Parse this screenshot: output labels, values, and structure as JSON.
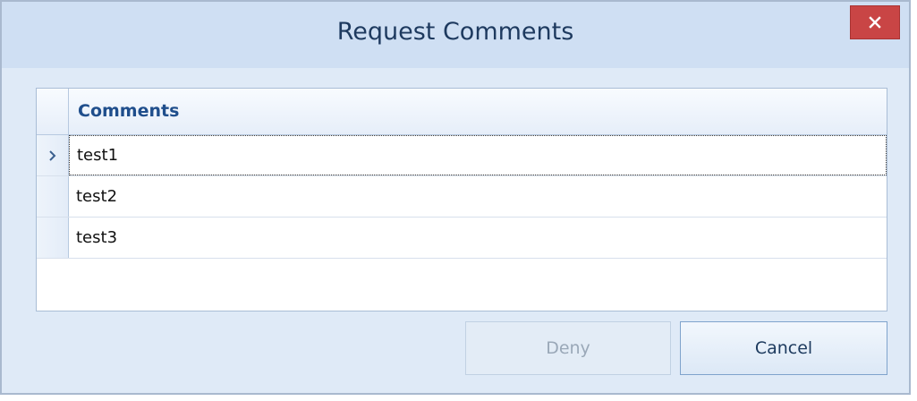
{
  "window": {
    "title": "Request Comments",
    "close_icon": "close-icon"
  },
  "grid": {
    "column_header": "Comments",
    "current_row_icon": "chevron-right-icon",
    "rows": [
      {
        "comment": "test1",
        "current": true
      },
      {
        "comment": "test2",
        "current": false
      },
      {
        "comment": "test3",
        "current": false
      }
    ]
  },
  "buttons": {
    "deny_label": "Deny",
    "deny_enabled": false,
    "cancel_label": "Cancel"
  },
  "colors": {
    "titlebar": "#cfdff3",
    "close_button": "#c94545",
    "header_text": "#1f4e8c",
    "disabled_text": "#9aa8b8"
  }
}
